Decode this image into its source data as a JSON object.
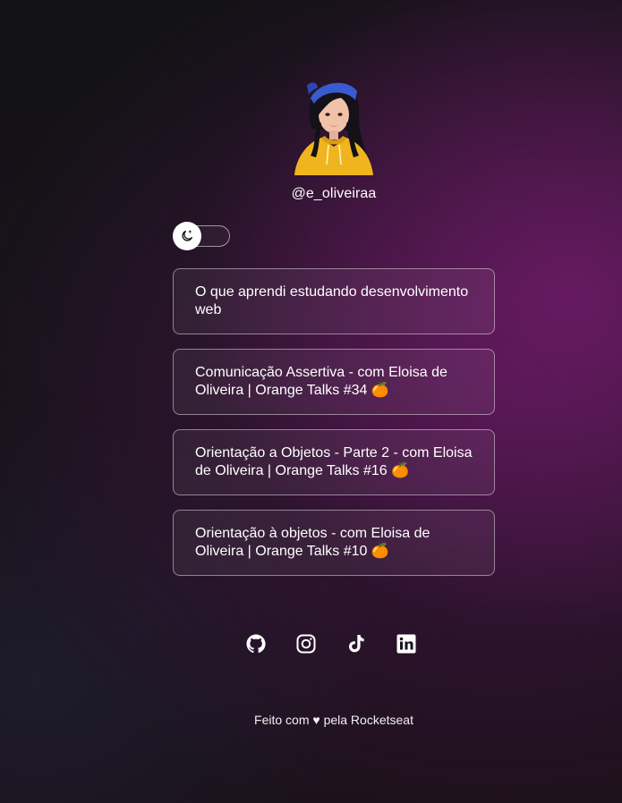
{
  "profile": {
    "username": "@e_oliveiraa",
    "avatar": "3d-avatar-girl-yellow-hoodie"
  },
  "theme_toggle": {
    "icon": "moon-icon",
    "state": "dark"
  },
  "links": [
    {
      "label": "O que aprendi estudando desenvolvimento web"
    },
    {
      "label": "Comunicação Assertiva - com Eloisa de Oliveira | Orange Talks #34 🍊"
    },
    {
      "label": "Orientação a Objetos - Parte 2 - com Eloisa de Oliveira | Orange Talks #16 🍊"
    },
    {
      "label": "Orientação à objetos - com Eloisa de Oliveira | Orange Talks #10 🍊"
    }
  ],
  "socials": [
    {
      "icon": "github-icon"
    },
    {
      "icon": "instagram-icon"
    },
    {
      "icon": "tiktok-icon"
    },
    {
      "icon": "linkedin-icon"
    }
  ],
  "footer": {
    "text": "Feito com ♥ pela Rocketseat"
  },
  "colors": {
    "background": "#121215",
    "accent_purple": "#761c6e",
    "text": "#ffffff"
  }
}
